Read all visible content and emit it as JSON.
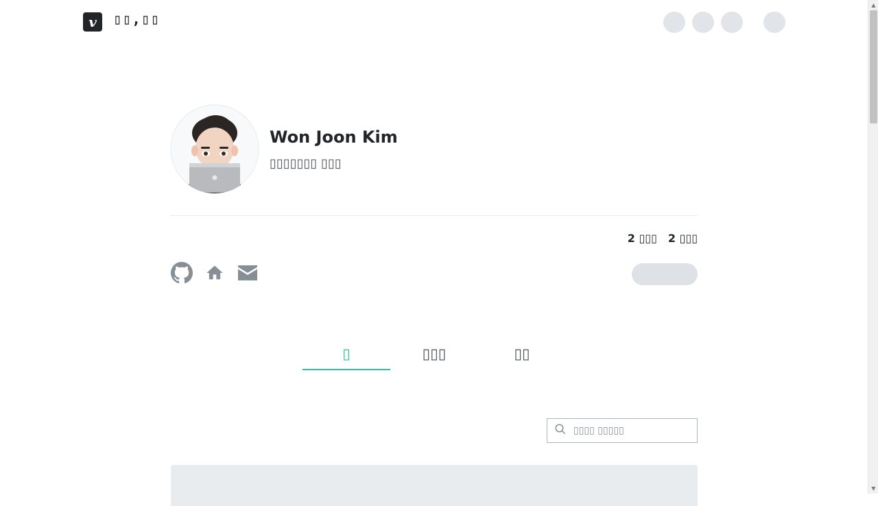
{
  "header": {
    "logo_letter": "v",
    "blog_name": "▯▯,▯▯"
  },
  "profile": {
    "name": "Won Joon Kim",
    "bio": "▯▯▯▯▯▯▯ ▯▯▯",
    "followers": "2 ▯▯▯",
    "following": "2 ▯▯▯"
  },
  "tabs": [
    {
      "label": "▯",
      "active": true
    },
    {
      "label": "▯▯▯",
      "active": false
    },
    {
      "label": "▯▯",
      "active": false
    }
  ],
  "search": {
    "placeholder": "▯▯▯▯ ▯▯▯▯▯"
  },
  "colors": {
    "accent": "#20c997",
    "skeleton": "#e1e4e8",
    "text": "#212529"
  },
  "icons": [
    "github-icon",
    "home-icon",
    "email-icon",
    "search-icon"
  ]
}
